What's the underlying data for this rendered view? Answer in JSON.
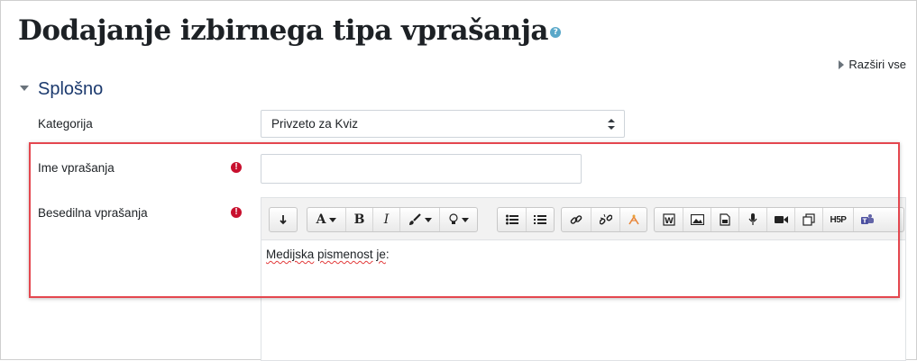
{
  "page": {
    "title": "Dodajanje izbirnega tipa vprašanja",
    "help_icon_glyph": "?",
    "expand_all_label": "Razširi vse"
  },
  "section": {
    "title": "Splošno"
  },
  "fields": {
    "category": {
      "label": "Kategorija",
      "value": "Privzeto za Kviz"
    },
    "question_name": {
      "label": "Ime vprašanja",
      "value": "",
      "required_glyph": "!"
    },
    "question_text": {
      "label": "Besedilna vprašanja",
      "required_glyph": "!",
      "content_words": [
        "Medijska",
        "pismenost",
        "je",
        ":"
      ]
    }
  },
  "toolbar": {
    "buttons": [
      "collapse-icon",
      "font-color-icon",
      "bold-icon",
      "italic-icon",
      "paint-brush-icon",
      "lightbulb-icon",
      "unordered-list-icon",
      "ordered-list-icon",
      "link-icon",
      "unlink-icon",
      "media-manager-icon",
      "word-import-icon",
      "image-icon",
      "file-icon",
      "microphone-icon",
      "video-camera-icon",
      "copy-icon",
      "h5p-icon",
      "teams-icon"
    ],
    "bold_glyph": "B",
    "italic_glyph": "I",
    "font_glyph": "A",
    "h5p_glyph": "H5P"
  },
  "colors": {
    "highlight_border": "#e4474f",
    "section_title": "#1c3a6e",
    "required": "#c8102e",
    "help": "#5aa8c9"
  }
}
